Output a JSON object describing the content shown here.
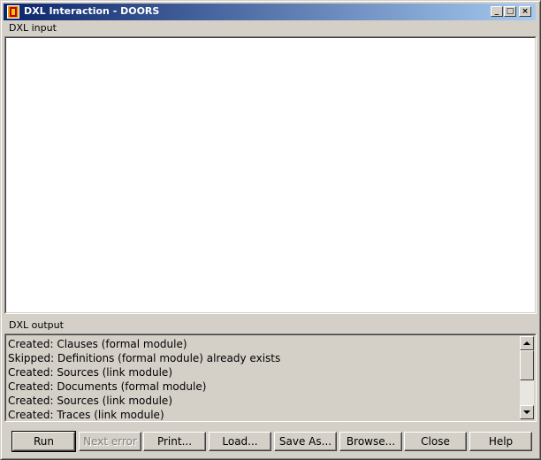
{
  "window": {
    "title": "DXL Interaction - DOORS",
    "buttons": {
      "minimize": "_",
      "maximize": "□",
      "close": "×"
    }
  },
  "input": {
    "label": "DXL input",
    "value": ""
  },
  "output": {
    "label": "DXL output",
    "lines": [
      "Created: Clauses (formal module)",
      "Skipped: Definitions (formal module) already exists",
      "Created: Sources (link module)",
      "Created: Documents (formal module)",
      "Created: Sources (link module)",
      "Created: Traces (link module)"
    ]
  },
  "buttons": {
    "run": "Run",
    "next_error": "Next error",
    "print": "Print...",
    "load": "Load...",
    "save_as": "Save As...",
    "browse": "Browse...",
    "close": "Close",
    "help": "Help"
  },
  "colors": {
    "titlebar_start": "#0a246a",
    "titlebar_end": "#a6caf0",
    "face": "#d4d0c8"
  }
}
